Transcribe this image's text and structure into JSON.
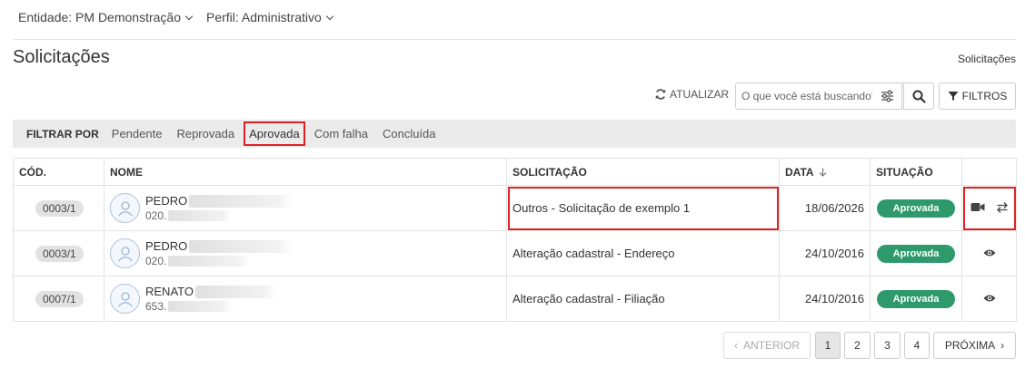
{
  "topbar": {
    "entity": "Entidade: PM Demonstração",
    "profile": "Perfil: Administrativo"
  },
  "page": {
    "title": "Solicitações",
    "breadcrumb": "Solicitações"
  },
  "toolbar": {
    "refresh_label": "ATUALIZAR",
    "search_placeholder": "O que você está buscando?",
    "filters_label": "FILTROS"
  },
  "filterbar": {
    "label": "FILTRAR POR",
    "options": [
      "Pendente",
      "Reprovada",
      "Aprovada",
      "Com falha",
      "Concluída"
    ],
    "active": "Aprovada"
  },
  "table": {
    "headers": {
      "code": "CÓD.",
      "name": "NOME",
      "request": "SOLICITAÇÃO",
      "date": "DATA",
      "status": "SITUAÇÃO"
    },
    "rows": [
      {
        "code": "0003/1",
        "name": "PEDRO",
        "doc": "020.",
        "request": "Outros - Solicitação de exemplo 1",
        "date": "18/06/2026",
        "status": "Aprovada"
      },
      {
        "code": "0003/1",
        "name": "PEDRO",
        "doc": "020.",
        "request": "Alteração cadastral - Endereço",
        "date": "24/10/2016",
        "status": "Aprovada"
      },
      {
        "code": "0007/1",
        "name": "RENATO",
        "doc": "653.",
        "request": "Alteração cadastral - Filiação",
        "date": "24/10/2016",
        "status": "Aprovada"
      }
    ]
  },
  "pagination": {
    "prev": "ANTERIOR",
    "pages": [
      "1",
      "2",
      "3",
      "4"
    ],
    "current": "1",
    "next": "PRÓXIMA"
  },
  "colors": {
    "status_green": "#2e9a6c",
    "highlight_red": "#e02020"
  }
}
